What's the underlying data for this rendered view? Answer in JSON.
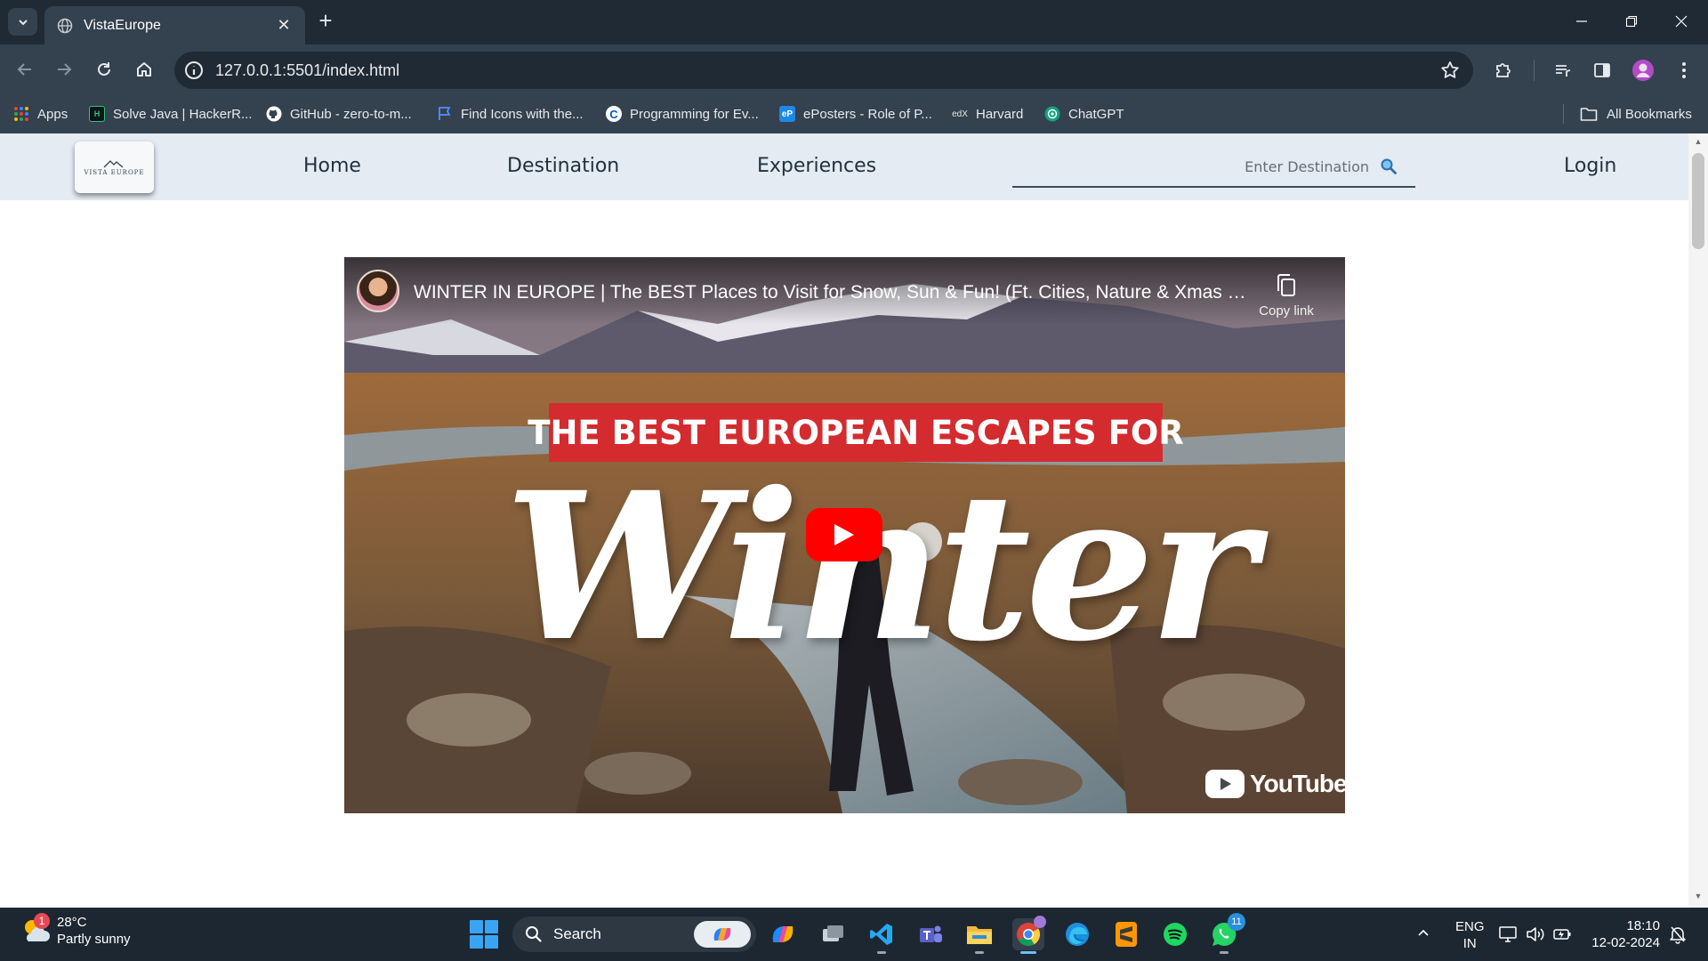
{
  "browser": {
    "tab_title": "VistaEurope",
    "url": "127.0.0.1:5501/index.html",
    "bookmarks": [
      {
        "label": "Apps",
        "icon": "apps-grid-icon"
      },
      {
        "label": "Solve Java | HackerR...",
        "icon": "hackerrank-icon"
      },
      {
        "label": "GitHub - zero-to-m...",
        "icon": "github-icon"
      },
      {
        "label": "Find Icons with the...",
        "icon": "flag-icon"
      },
      {
        "label": "Programming for Ev...",
        "icon": "coursera-icon"
      },
      {
        "label": "ePosters - Role of P...",
        "icon": "eposters-icon"
      },
      {
        "label": "Harvard",
        "icon": "edx-icon"
      },
      {
        "label": "ChatGPT",
        "icon": "chatgpt-icon"
      }
    ],
    "all_bookmarks_label": "All Bookmarks"
  },
  "site": {
    "logo_text": "VISTA EUROPE",
    "nav": {
      "home": "Home",
      "destination": "Destination",
      "experiences": "Experiences",
      "login": "Login"
    },
    "search": {
      "placeholder": "Enter Destination",
      "value": ""
    }
  },
  "video": {
    "title": "WINTER IN EUROPE | The BEST Places to Visit for Snow, Sun & Fun! (Ft. Cities, Nature & Xmas Markets)",
    "copy_link_label": "Copy link",
    "banner_text": "THE BEST EUROPEAN ESCAPES FOR",
    "script_text": "Winter",
    "brand": "YouTube"
  },
  "taskbar": {
    "weather": {
      "temp": "28°C",
      "condition": "Partly sunny",
      "badge": "1"
    },
    "search_label": "Search",
    "apps": [
      {
        "name": "copilot-app-icon"
      },
      {
        "name": "task-view-icon"
      },
      {
        "name": "vscode-icon"
      },
      {
        "name": "teams-icon"
      },
      {
        "name": "file-explorer-icon"
      },
      {
        "name": "chrome-icon",
        "active": true
      },
      {
        "name": "edge-icon"
      },
      {
        "name": "sublime-text-icon"
      },
      {
        "name": "spotify-icon"
      },
      {
        "name": "whatsapp-icon",
        "badge": "11"
      }
    ],
    "language": {
      "line1": "ENG",
      "line2": "IN"
    },
    "time": "18:10",
    "date": "12-02-2024"
  },
  "colors": {
    "chrome_dark": "#1f2a35",
    "chrome_mid": "#34414e",
    "site_nav_bg": "#e4ebf2",
    "banner_red": "#d42b2f",
    "youtube_red": "#ff0000",
    "taskbar_bg": "#1d2731"
  }
}
